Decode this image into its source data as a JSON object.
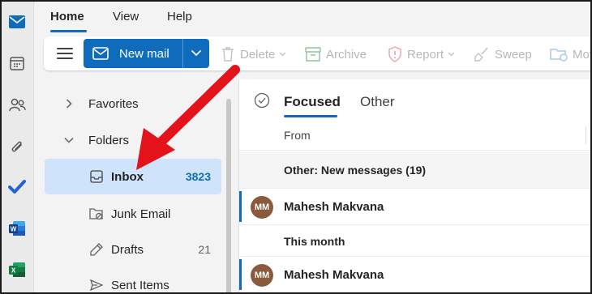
{
  "tabs": {
    "home": "Home",
    "view": "View",
    "help": "Help"
  },
  "ribbon": {
    "new_mail": "New mail",
    "delete": "Delete",
    "archive": "Archive",
    "report": "Report",
    "sweep": "Sweep",
    "move": "Mov"
  },
  "rail": {
    "icons": [
      "mail-icon",
      "calendar-icon",
      "people-icon",
      "attachment-icon",
      "todo-icon",
      "word-icon",
      "excel-icon"
    ],
    "accent": "#0f6cbd"
  },
  "folders": {
    "favorites": "Favorites",
    "folders": "Folders",
    "items": [
      {
        "label": "Inbox",
        "count": "3823",
        "icon": "inbox-icon",
        "selected": true
      },
      {
        "label": "Junk Email",
        "count": "",
        "icon": "junk-icon"
      },
      {
        "label": "Drafts",
        "count": "21",
        "icon": "drafts-icon"
      },
      {
        "label": "Sent Items",
        "count": "",
        "icon": "sent-icon"
      }
    ]
  },
  "list": {
    "tab_focused": "Focused",
    "tab_other": "Other",
    "column_from": "From",
    "group_other": "Other: New messages (19)",
    "group_month": "This month",
    "messages": [
      {
        "initials": "MM",
        "sender": "Mahesh Makvana"
      },
      {
        "initials": "MM",
        "sender": "Mahesh Makvana"
      }
    ]
  },
  "colors": {
    "brand_blue": "#0f6cbd",
    "selected_bg": "#cfe4fa",
    "annotation_arrow": "#e3121b",
    "avatar": "#8b5a3c"
  }
}
